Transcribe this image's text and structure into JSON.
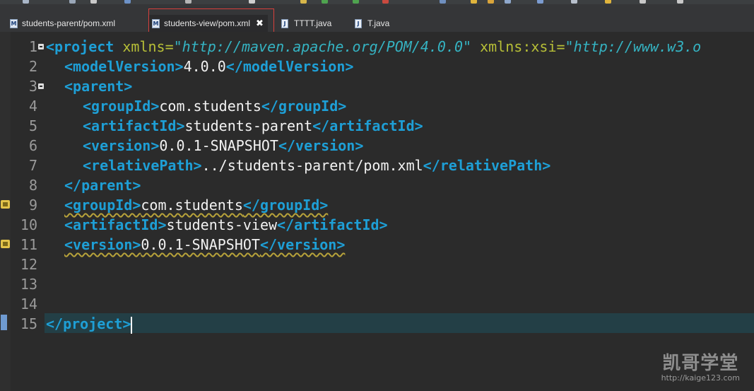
{
  "tabs": [
    {
      "label": "students-parent/pom.xml",
      "icon": "maven-pom-icon",
      "active": false
    },
    {
      "label": "students-view/pom.xml",
      "icon": "maven-pom-icon",
      "active": true
    },
    {
      "label": "TTTT.java",
      "icon": "java-file-icon",
      "active": false
    },
    {
      "label": "T.java",
      "icon": "java-file-icon",
      "active": false
    }
  ],
  "tab_close_glyph": "✖",
  "editor": {
    "line_numbers": [
      "1",
      "2",
      "3",
      "4",
      "5",
      "6",
      "7",
      "8",
      "9",
      "10",
      "11",
      "12",
      "13",
      "14",
      "15"
    ],
    "code": {
      "l1_open": "<project",
      "l1_attr1": "xmlns=",
      "l1_val1": "\"http://maven.apache.org/POM/4.0.0\"",
      "l1_attr2": "xmlns:xsi=",
      "l1_val2": "\"http://www.w3.o",
      "modelVersion_open": "<modelVersion>",
      "modelVersion_text": "4.0.0",
      "modelVersion_close": "</modelVersion>",
      "parent_open": "<parent>",
      "p_groupId_open": "<groupId>",
      "p_groupId_text": "com.students",
      "p_groupId_close": "</groupId>",
      "p_artifactId_open": "<artifactId>",
      "p_artifactId_text": "students-parent",
      "p_artifactId_close": "</artifactId>",
      "p_version_open": "<version>",
      "p_version_text": "0.0.1-SNAPSHOT",
      "p_version_close": "</version>",
      "p_relativePath_open": "<relativePath>",
      "p_relativePath_text": "../students-parent/pom.xml",
      "p_relativePath_close": "</relativePath>",
      "parent_close": "</parent>",
      "groupId_open": "<groupId>",
      "groupId_text": "com.students",
      "groupId_close": "</groupId>",
      "artifactId_open": "<artifactId>",
      "artifactId_text": "students-view",
      "artifactId_close": "</artifactId>",
      "version_open": "<version>",
      "version_text": "0.0.1-SNAPSHOT",
      "version_close": "</version>",
      "project_close": "</project>"
    }
  },
  "watermark": {
    "logo": "凯哥学堂",
    "url": "http://kaige123.com"
  },
  "colors": {
    "tag": "#1e9fd6",
    "attribute": "#b7bf37",
    "attr_value": "#35b3c2",
    "text": "#f2f2f2",
    "line_number": "#9a9a9a",
    "current_line": "#233f46",
    "highlight_box": "#d8403c",
    "warning": "#e2c34a"
  }
}
